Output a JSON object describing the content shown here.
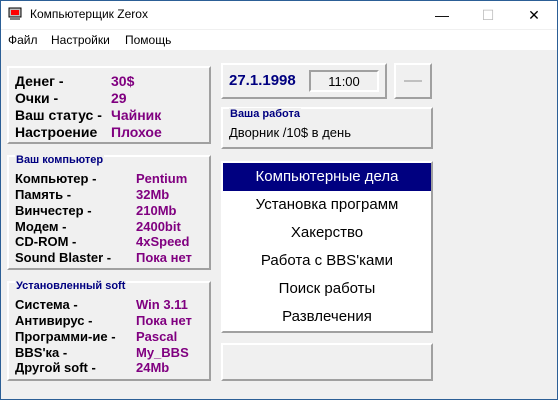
{
  "title": "Компьютерщик Zerox",
  "window_buttons": {
    "minimize": "—",
    "maximize": "☐",
    "close": "✕"
  },
  "menu": [
    "Файл",
    "Настройки",
    "Помощь"
  ],
  "status": {
    "money_label": "Денег -",
    "money": "30$",
    "score_label": "Очки -",
    "score": "29",
    "rank_label": "Ваш статус -",
    "rank": "Чайник",
    "mood_label": "Настроение",
    "mood": "Плохое"
  },
  "datetime": {
    "date": "27.1.1998",
    "time": "11:00"
  },
  "job": {
    "title": "Ваша работа",
    "text": "Дворник  /10$ в день"
  },
  "computer": {
    "title": "Ваш компьютер",
    "rows": [
      {
        "label": "Компьютер -",
        "value": "Pentium"
      },
      {
        "label": "Память -",
        "value": "32Mb"
      },
      {
        "label": "Винчестер -",
        "value": "210Mb"
      },
      {
        "label": "Модем -",
        "value": "2400bit"
      },
      {
        "label": "CD-ROM -",
        "value": "4xSpeed"
      },
      {
        "label": "Sound Blaster -",
        "value": "Пока нет"
      }
    ]
  },
  "software": {
    "title": "Установленный soft",
    "rows": [
      {
        "label": "Система -",
        "value": "Win 3.11"
      },
      {
        "label": "Антивирус -",
        "value": "Пока нет"
      },
      {
        "label": "Программи-ие -",
        "value": "Pascal"
      },
      {
        "label": "BBS'ка -",
        "value": "My_BBS"
      },
      {
        "label": "Другой soft -",
        "value": "24Mb"
      }
    ]
  },
  "actions": [
    "Компьютерные дела",
    "Установка  программ",
    "Хакерство",
    "Работа с BBS'ками",
    "Поиск работы",
    "Развлечения"
  ],
  "colors": {
    "value_text": "#800080",
    "date_text": "#000080",
    "selection": "#000080",
    "group_title": "#000080"
  }
}
